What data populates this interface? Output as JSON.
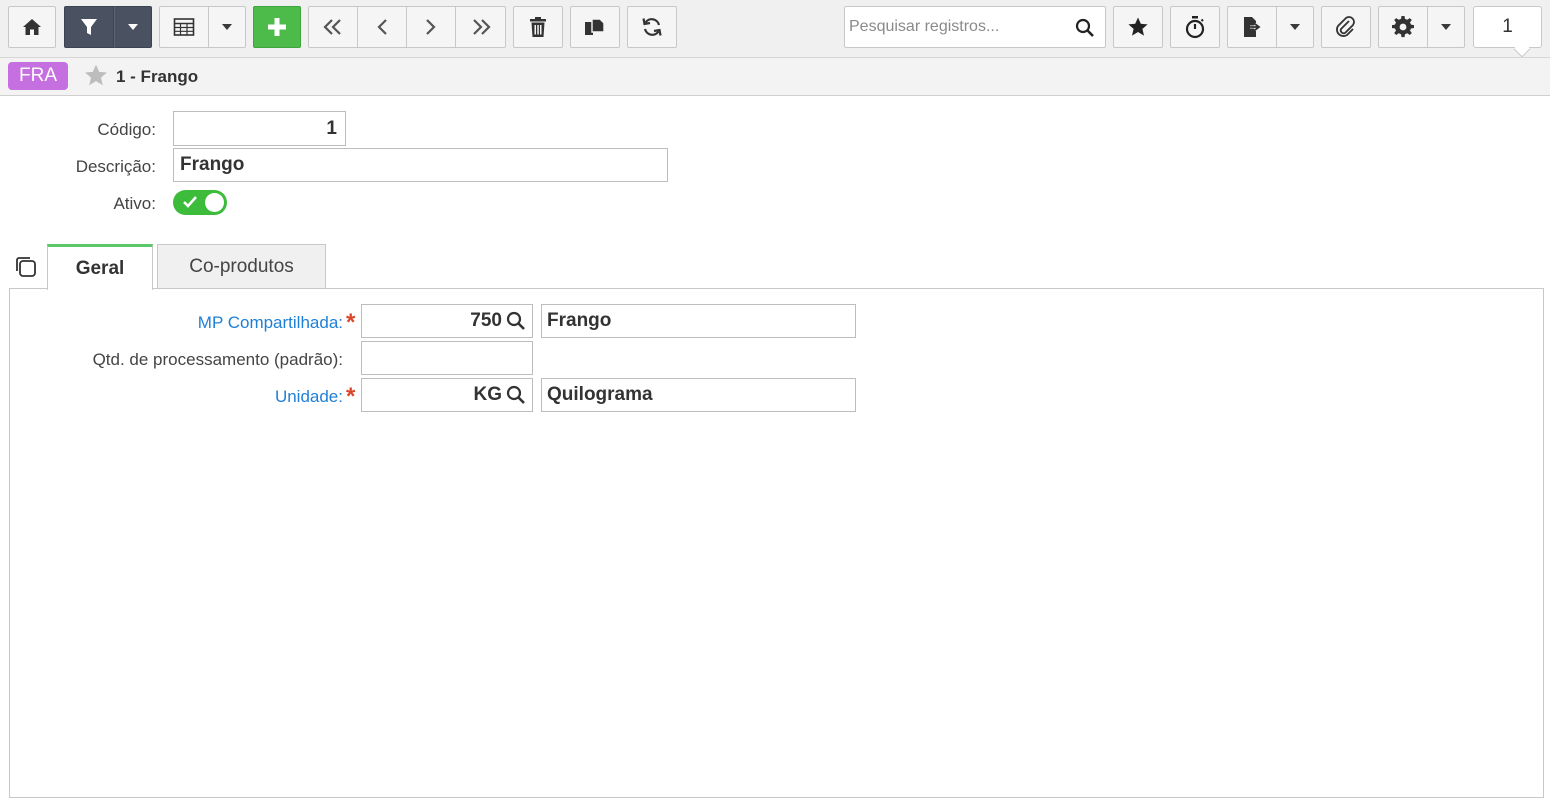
{
  "toolbar": {
    "buttons": [
      {
        "name": "home",
        "icon": "home-icon"
      },
      {
        "name": "filter",
        "icon": "filter-icon"
      },
      {
        "name": "grid-view",
        "icon": "table-icon"
      },
      {
        "name": "new",
        "icon": "plus-icon"
      },
      {
        "name": "first",
        "icon": "double-chevron-left-icon"
      },
      {
        "name": "previous",
        "icon": "chevron-left-icon"
      },
      {
        "name": "next",
        "icon": "chevron-right-icon"
      },
      {
        "name": "last",
        "icon": "double-chevron-right-icon"
      },
      {
        "name": "delete",
        "icon": "trash-icon"
      },
      {
        "name": "copy",
        "icon": "copy-icon"
      },
      {
        "name": "refresh",
        "icon": "refresh-icon"
      },
      {
        "name": "favorite",
        "icon": "star-icon"
      },
      {
        "name": "timer",
        "icon": "stopwatch-icon"
      },
      {
        "name": "export",
        "icon": "export-icon"
      },
      {
        "name": "attach",
        "icon": "paperclip-icon"
      },
      {
        "name": "settings",
        "icon": "gear-icon"
      }
    ],
    "search_placeholder": "Pesquisar registros...",
    "page_number": "1"
  },
  "breadcrumb": {
    "badge": "FRA",
    "title": "1 - Frango"
  },
  "form": {
    "codigo_label": "Código:",
    "codigo_value": "1",
    "descricao_label": "Descrição:",
    "descricao_value": "Frango",
    "ativo_label": "Ativo:",
    "ativo_value": true
  },
  "tabs": [
    {
      "label": "Geral",
      "active": true
    },
    {
      "label": "Co-produtos",
      "active": false
    }
  ],
  "geral": {
    "mp_label": "MP Compartilhada:",
    "mp_code": "750",
    "mp_desc": "Frango",
    "qtd_label": "Qtd. de processamento (padrão):",
    "qtd_value": "",
    "unidade_label": "Unidade:",
    "unidade_code": "KG",
    "unidade_desc": "Quilograma",
    "required_mark": "*"
  },
  "colors": {
    "badge": "#c66fe0",
    "primary_button": "#4cbb4a",
    "filter_button": "#4a5160",
    "link_label": "#1f7fd6",
    "required": "#d9472b",
    "toggle_on": "#3dbb3b",
    "active_tab_accent": "#5cc76a"
  }
}
